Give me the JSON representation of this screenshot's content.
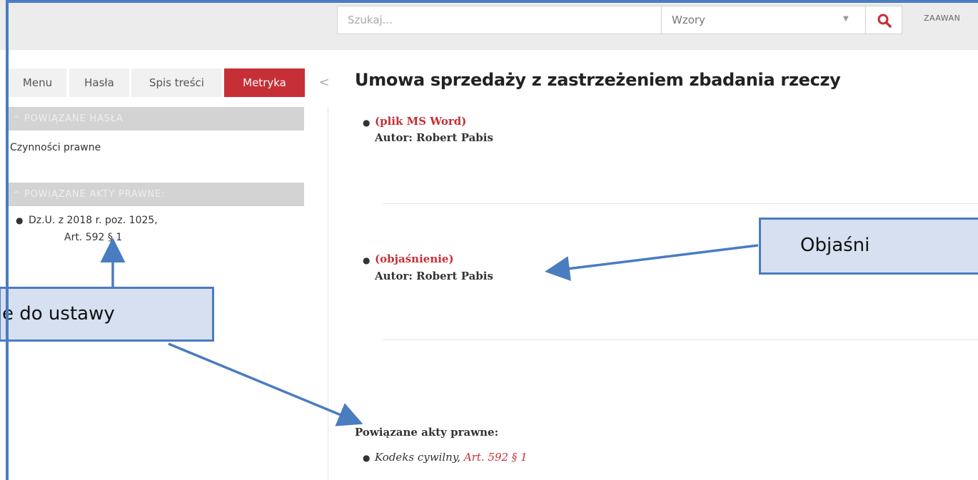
{
  "search": {
    "placeholder": "Szukaj...",
    "type_value": "Wzory",
    "advanced_label": "ZAAWAN"
  },
  "sidebar": {
    "tabs": [
      "Menu",
      "Hasła",
      "Spis treści",
      "Metryka"
    ],
    "active_tab": "Metryka",
    "collapse_glyph": "<",
    "sections": [
      {
        "heading": "POWIĄZANE HASŁA",
        "items": [
          "Czynności prawne"
        ]
      },
      {
        "heading": "POWIĄZANE AKTY PRAWNE:",
        "items": [
          {
            "line1": "Dz.U. z 2018 r. poz. 1025,",
            "line2": "Art. 592 § 1"
          }
        ]
      }
    ]
  },
  "document": {
    "title": "Umowa sprzedaży z zastrzeżeniem zbadania rzeczy",
    "entries": [
      {
        "link": "(plik MS Word)",
        "author": "Autor: Robert Pabis"
      },
      {
        "link": "(objaśnienie)",
        "author": "Autor: Robert Pabis"
      }
    ],
    "related": {
      "heading": "Powiązane akty prawne:",
      "code": "Kodeks cywilny,",
      "article": "Art. 592 § 1"
    }
  },
  "annotations": [
    {
      "text": "e do ustawy"
    },
    {
      "text": "Objaśni"
    }
  ],
  "colors": {
    "accent": "#c62f36",
    "annotation_border": "#4a7cc0",
    "annotation_fill": "#d7e0f0"
  },
  "icons": {
    "search_button": "search-icon"
  }
}
